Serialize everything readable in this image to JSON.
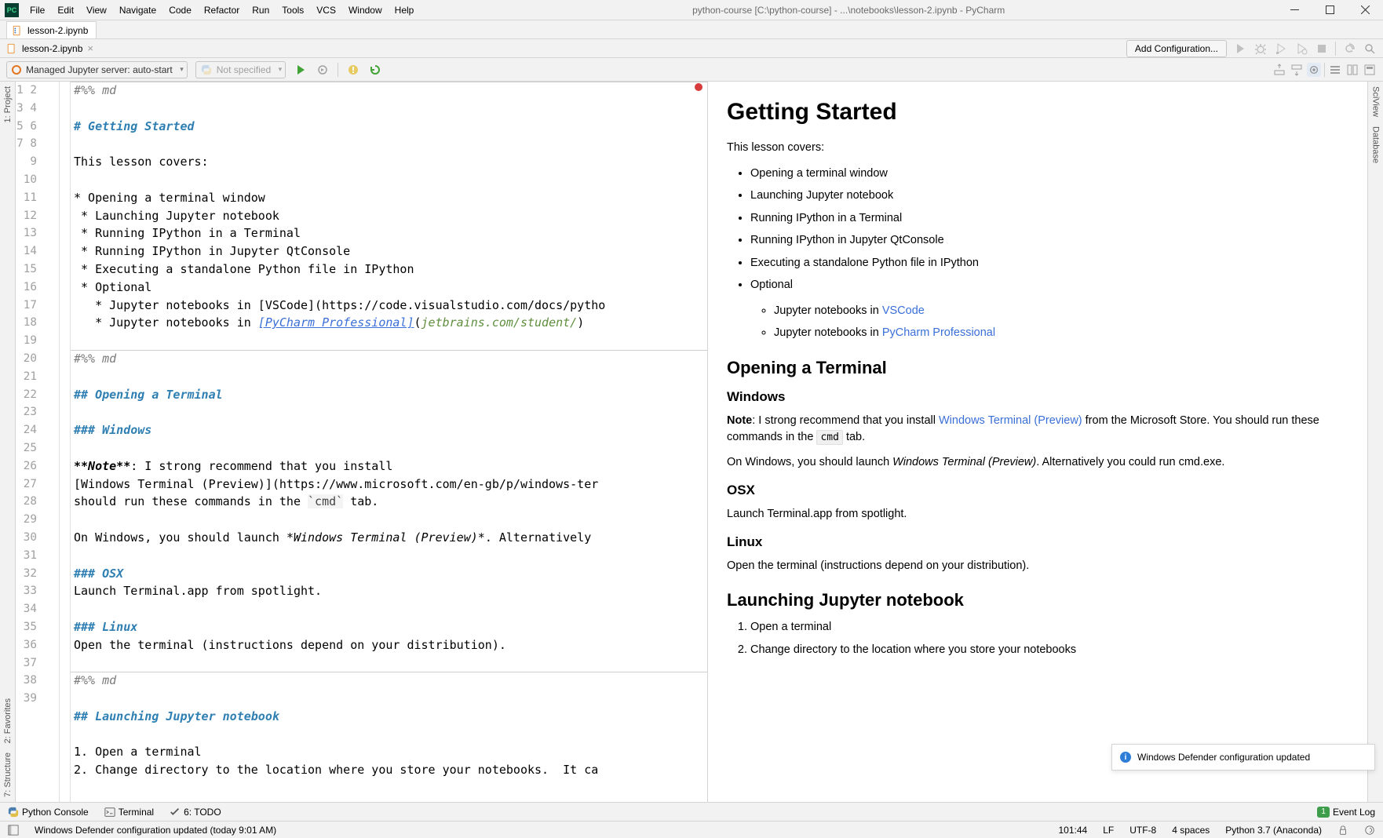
{
  "window": {
    "title_path": "python-course [C:\\python-course] - ...\\notebooks\\lesson-2.ipynb - PyCharm"
  },
  "menu": [
    "File",
    "Edit",
    "View",
    "Navigate",
    "Code",
    "Refactor",
    "Run",
    "Tools",
    "VCS",
    "Window",
    "Help"
  ],
  "tabs": {
    "file": "lesson-2.ipynb"
  },
  "breadcrumb": {
    "file": "lesson-2.ipynb"
  },
  "nav_right": {
    "add_config": "Add Configuration..."
  },
  "toolbar": {
    "managed": "Managed Jupyter server: auto-start",
    "notspec": "Not specified"
  },
  "side": {
    "left1": "1: Project",
    "left2": "2: Favorites",
    "left3": "7: Structure",
    "right1": "SciView",
    "right2": "Database"
  },
  "code_text": "#%% md\n\n# Getting Started\n\nThis lesson covers:\n\n* Opening a terminal window\n * Launching Jupyter notebook\n * Running IPython in a Terminal\n * Running IPython in Jupyter QtConsole\n * Executing a standalone Python file in IPython\n * Optional\n   * Jupyter notebooks in [VSCode](https://code.visualstudio.com/docs/pytho\n   * Jupyter notebooks in [PyCharm Professional](jetbrains.com/student/)\n\n#%% md\n\n## Opening a Terminal\n\n### Windows\n\n**Note**: I strong recommend that you install\n[Windows Terminal (Preview)](https://www.microsoft.com/en-gb/p/windows-ter\nshould run these commands in the `cmd` tab.\n\nOn Windows, you should launch *Windows Terminal (Preview)*. Alternatively\n\n### OSX\nLaunch Terminal.app from spotlight.\n\n### Linux\nOpen the terminal (instructions depend on your distribution).\n\n#%% md\n\n## Launching Jupyter notebook\n\n1. Open a terminal\n2. Change directory to the location where you store your notebooks.  It ca",
  "preview": {
    "h1": "Getting Started",
    "intro": "This lesson covers:",
    "bullets": [
      "Opening a terminal window",
      "Launching Jupyter notebook",
      "Running IPython in a Terminal",
      "Running IPython in Jupyter QtConsole",
      "Executing a standalone Python file in IPython",
      "Optional"
    ],
    "sub_pre": "Jupyter notebooks in ",
    "vscode": "VSCode",
    "pycharm": "PyCharm Professional",
    "h2a": "Opening a Terminal",
    "h3_win": "Windows",
    "win_note_lbl": "Note",
    "win_note_1": ": I strong recommend that you install ",
    "wtp": "Windows Terminal (Preview)",
    "win_note_2": " from the Microsoft Store. You should run these commands in the ",
    "cmd": "cmd",
    "win_note_3": " tab.",
    "win_p2a": "On Windows, you should launch ",
    "win_p2i": "Windows Terminal (Preview)",
    "win_p2b": ". Alternatively you could run cmd.exe.",
    "h3_osx": "OSX",
    "osx_p": "Launch Terminal.app from spotlight.",
    "h3_linux": "Linux",
    "linux_p": "Open the terminal (instructions depend on your distribution).",
    "h2b": "Launching Jupyter notebook",
    "ol1": "Open a terminal",
    "ol2": "Change directory to the location where you store your notebooks"
  },
  "notification": {
    "text": "Windows Defender configuration updated"
  },
  "bottombar": {
    "python_console": "Python Console",
    "terminal": "Terminal",
    "todo": "6: TODO",
    "event_log": "Event Log"
  },
  "status": {
    "msg": "Windows Defender configuration updated (today 9:01 AM)",
    "pos": "101:44",
    "lf": "LF",
    "enc": "UTF-8",
    "indent": "4 spaces",
    "interp": "Python 3.7 (Anaconda)"
  }
}
